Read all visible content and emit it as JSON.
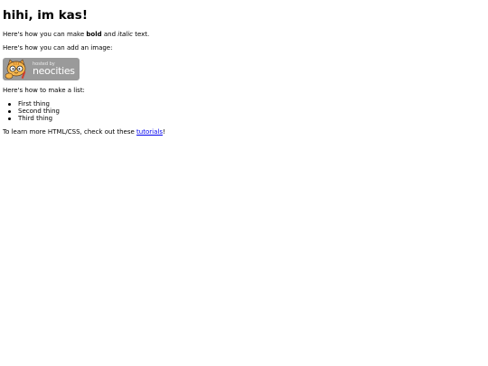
{
  "page": {
    "title": "hihi, im kas!",
    "p1": {
      "before": "Here's how you can make ",
      "bold": "bold",
      "middle": " and ",
      "italic": "italic",
      "after": " text."
    },
    "p2": "Here's how you can add an image:",
    "badge": {
      "line1": "hosted by",
      "line2": "neocities",
      "icon": "neocities-cat-icon"
    },
    "p3": "Here's how to make a list:",
    "list": [
      "First thing",
      "Second thing",
      "Third thing"
    ],
    "p4": {
      "before": "To learn more HTML/CSS, check out these ",
      "link": "tutorials",
      "after": "!"
    },
    "colors": {
      "link": "#0000ee",
      "badge_background": "#9a9a9a",
      "cat_orange": "#f2a33a"
    }
  }
}
